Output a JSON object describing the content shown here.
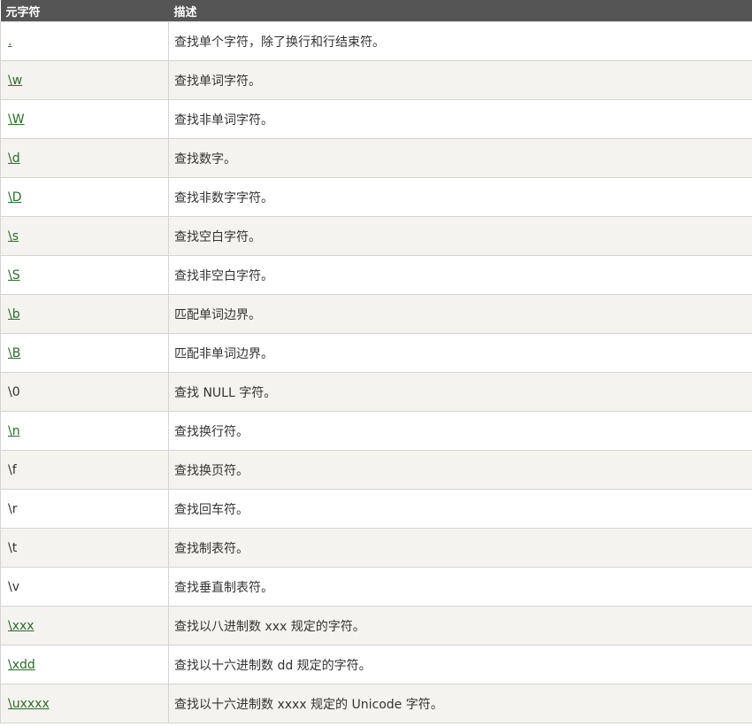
{
  "table": {
    "header": {
      "col1": "元字符",
      "col2": "描述"
    },
    "rows": [
      {
        "meta": ".",
        "desc": "查找单个字符，除了换行和行结束符。",
        "link": true
      },
      {
        "meta": "\\w",
        "desc": "查找单词字符。",
        "link": true
      },
      {
        "meta": "\\W",
        "desc": "查找非单词字符。",
        "link": true
      },
      {
        "meta": "\\d",
        "desc": "查找数字。",
        "link": true
      },
      {
        "meta": "\\D",
        "desc": "查找非数字字符。",
        "link": true
      },
      {
        "meta": "\\s",
        "desc": "查找空白字符。",
        "link": true
      },
      {
        "meta": "\\S",
        "desc": "查找非空白字符。",
        "link": true
      },
      {
        "meta": "\\b",
        "desc": "匹配单词边界。",
        "link": true
      },
      {
        "meta": "\\B",
        "desc": "匹配非单词边界。",
        "link": true
      },
      {
        "meta": "\\0",
        "desc": "查找 NULL 字符。",
        "link": false
      },
      {
        "meta": "\\n",
        "desc": "查找换行符。",
        "link": true
      },
      {
        "meta": "\\f",
        "desc": "查找换页符。",
        "link": false
      },
      {
        "meta": "\\r",
        "desc": "查找回车符。",
        "link": false
      },
      {
        "meta": "\\t",
        "desc": "查找制表符。",
        "link": false
      },
      {
        "meta": "\\v",
        "desc": "查找垂直制表符。",
        "link": false
      },
      {
        "meta": "\\xxx",
        "desc": "查找以八进制数 xxx 规定的字符。",
        "link": true
      },
      {
        "meta": "\\xdd",
        "desc": "查找以十六进制数 dd 规定的字符。",
        "link": true
      },
      {
        "meta": "\\uxxxx",
        "desc": "查找以十六进制数 xxxx 规定的 Unicode 字符。",
        "link": true
      }
    ]
  },
  "colors": {
    "header_bg": "#555555",
    "header_text": "#ffffff",
    "row_alt_bg": "#f4f3ef",
    "link": "#2a6d2a"
  }
}
